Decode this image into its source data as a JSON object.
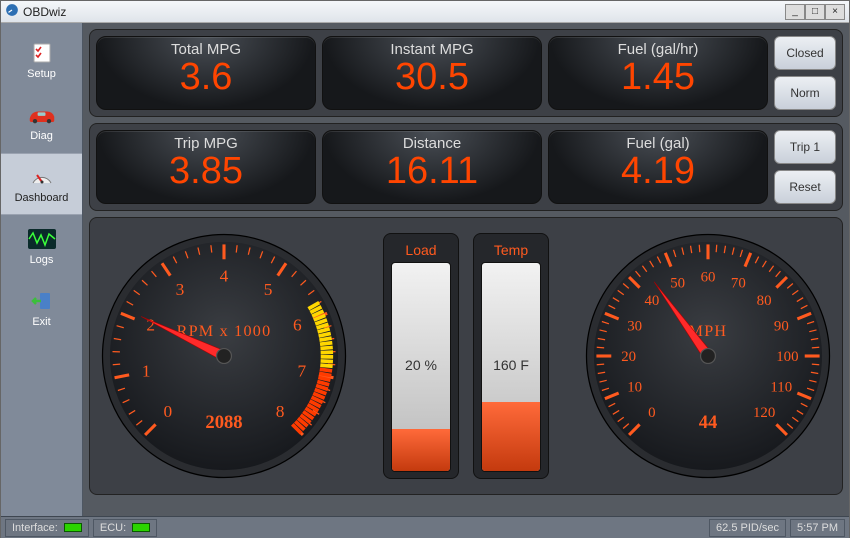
{
  "window": {
    "title": "OBDwiz"
  },
  "sidebar": {
    "items": [
      {
        "label": "Setup"
      },
      {
        "label": "Diag"
      },
      {
        "label": "Dashboard"
      },
      {
        "label": "Logs"
      },
      {
        "label": "Exit"
      }
    ]
  },
  "top_row": {
    "cells": [
      {
        "label": "Total MPG",
        "value": "3.6"
      },
      {
        "label": "Instant MPG",
        "value": "30.5"
      },
      {
        "label": "Fuel (gal/hr)",
        "value": "1.45"
      }
    ],
    "buttons": {
      "closed": "Closed",
      "norm": "Norm"
    }
  },
  "mid_row": {
    "cells": [
      {
        "label": "Trip MPG",
        "value": "3.85"
      },
      {
        "label": "Distance",
        "value": "16.11"
      },
      {
        "label": "Fuel (gal)",
        "value": "4.19"
      }
    ],
    "buttons": {
      "trip1": "Trip 1",
      "reset": "Reset"
    }
  },
  "gauges": {
    "rpm": {
      "title": "RPM x 1000",
      "value": "2088",
      "needle": 2.088,
      "min": 0,
      "max": 8
    },
    "mph": {
      "title": "MPH",
      "value": "44",
      "needle": 44,
      "min": 0,
      "max": 120
    }
  },
  "bars": {
    "load": {
      "label": "Load",
      "value": "20 %",
      "pct": 20
    },
    "temp": {
      "label": "Temp",
      "value": "160 F",
      "pct": 33
    }
  },
  "status": {
    "interface_label": "Interface:",
    "ecu_label": "ECU:",
    "pid": "62.5 PID/sec",
    "time": "5:57 PM"
  }
}
